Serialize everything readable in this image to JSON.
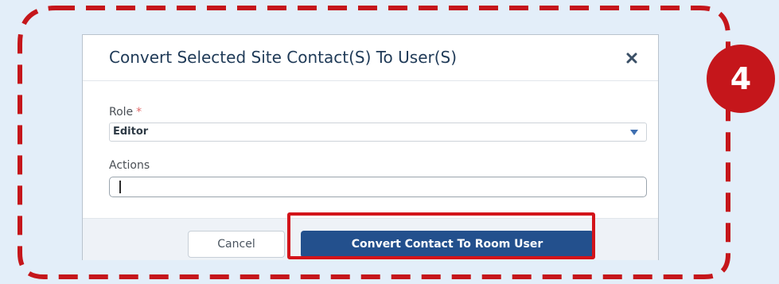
{
  "callout": {
    "step_number": "4",
    "accent_color": "#c5161b"
  },
  "dialog": {
    "title": "Convert Selected Site Contact(S) To User(S)",
    "close_icon": "close-icon",
    "role": {
      "label": "Role",
      "required_marker": "*",
      "selected_value": "Editor",
      "dropdown_icon": "dropdown-arrow-icon"
    },
    "actions": {
      "label": "Actions",
      "value": ""
    },
    "footer": {
      "cancel_label": "Cancel",
      "convert_label": "Convert Contact To Room User",
      "convert_color": "#23508d"
    }
  }
}
